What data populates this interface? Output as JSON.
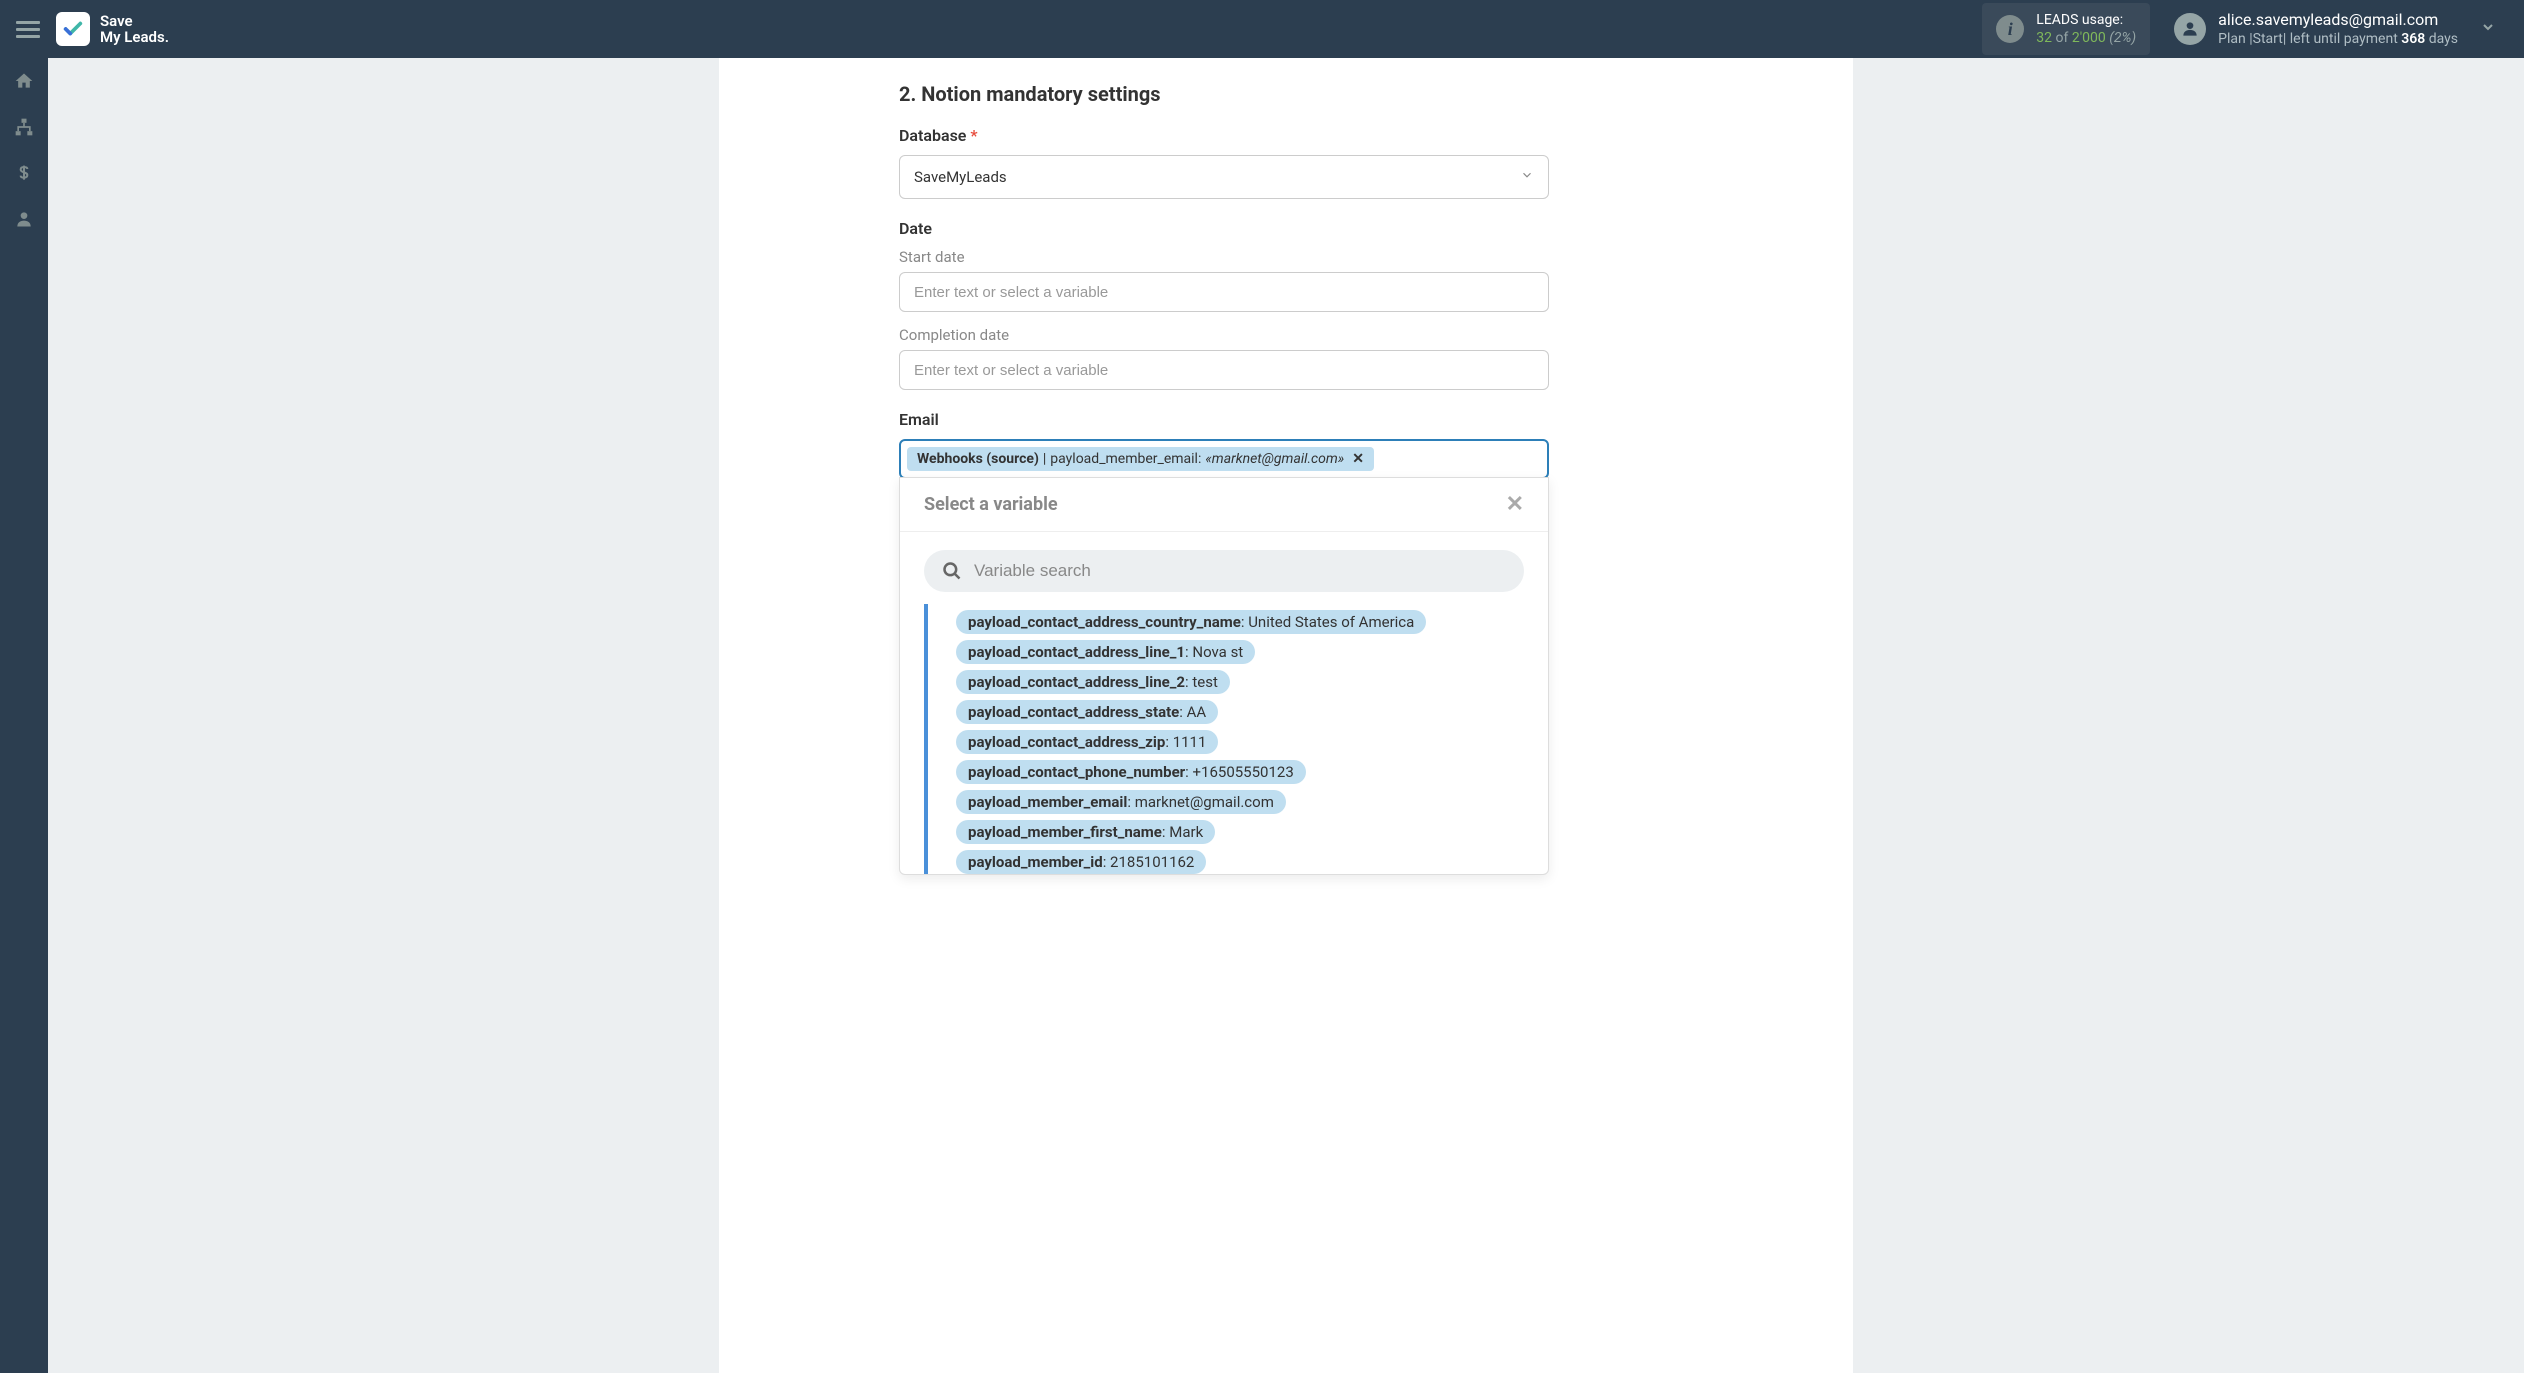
{
  "header": {
    "logo_line1": "Save",
    "logo_line2": "My Leads.",
    "usage_label": "LEADS usage:",
    "usage_used": "32",
    "usage_of": " of ",
    "usage_total": "2'000",
    "usage_pct": " (2%)",
    "user_email": "alice.savemyleads@gmail.com",
    "plan_prefix": "Plan |",
    "plan_name": "Start",
    "plan_mid": "| left until payment ",
    "plan_days": "368",
    "plan_suffix": " days"
  },
  "section": {
    "number": "2. ",
    "bold": "Notion",
    "rest": " mandatory settings"
  },
  "fields": {
    "database_label": "Database ",
    "database_value": "SaveMyLeads",
    "date_label": "Date",
    "start_date_label": "Start date",
    "start_date_placeholder": "Enter text or select a variable",
    "completion_date_label": "Completion date",
    "completion_date_placeholder": "Enter text or select a variable",
    "email_label": "Email"
  },
  "email_tag": {
    "source": "Webhooks (source)",
    "sep": " | ",
    "key": "payload_member_email: ",
    "sample": "«marknet@gmail.com»",
    "remove": "✕"
  },
  "dropdown": {
    "title": "Select a variable",
    "search_placeholder": "Variable search",
    "items": [
      {
        "key": "payload_contact_address_country_name",
        "value": ": United States of America"
      },
      {
        "key": "payload_contact_address_line_1",
        "value": ": Nova st"
      },
      {
        "key": "payload_contact_address_line_2",
        "value": ": test"
      },
      {
        "key": "payload_contact_address_state",
        "value": ": AA"
      },
      {
        "key": "payload_contact_address_zip",
        "value": ": 1111"
      },
      {
        "key": "payload_contact_phone_number",
        "value": ": +16505550123"
      },
      {
        "key": "payload_member_email",
        "value": ": marknet@gmail.com"
      },
      {
        "key": "payload_member_first_name",
        "value": ": Mark"
      },
      {
        "key": "payload_member_id",
        "value": ": 2185101162"
      }
    ]
  }
}
